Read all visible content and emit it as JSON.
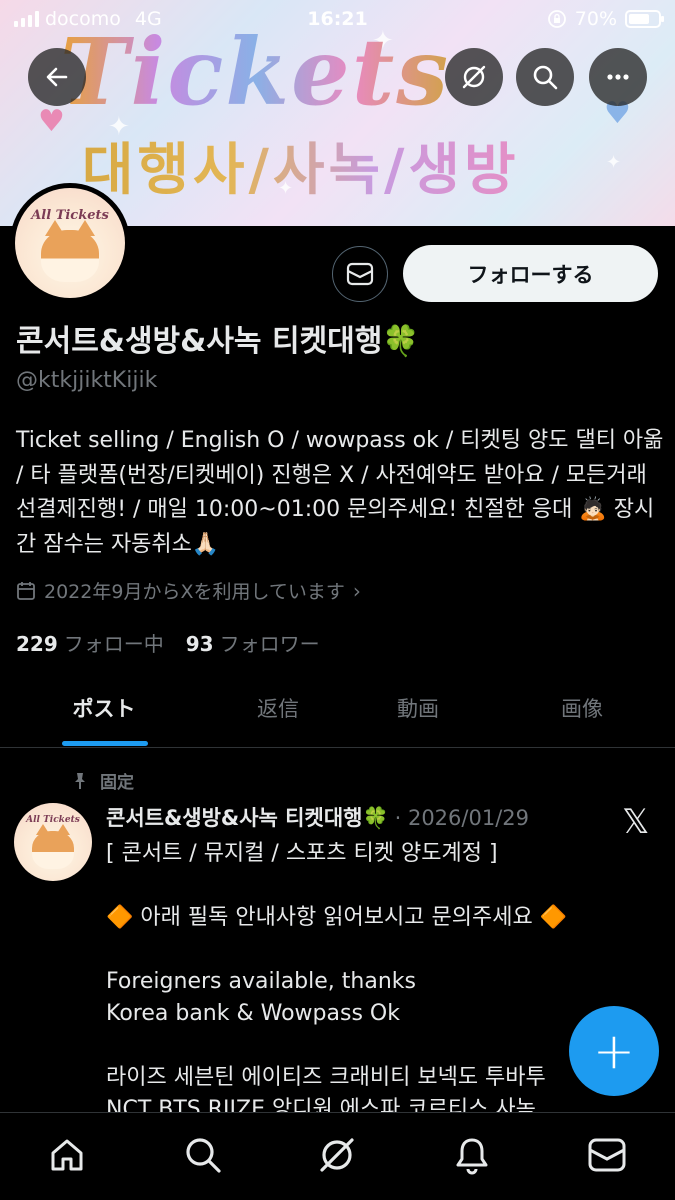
{
  "status_bar": {
    "carrier": "docomo",
    "network": "4G",
    "time": "16:21",
    "battery": "70%",
    "battery_level": 0.7
  },
  "banner": {
    "title": "Tickets",
    "subtitle": "대행사/사녹/생방"
  },
  "profile": {
    "avatar_label": "All Tickets",
    "follow_label": "フォローする",
    "display_name": "콘서트&생방&사녹 티켓대행🍀",
    "handle": "@ktkjjiktKijik",
    "bio": "Ticket selling / English O / wowpass ok / 티켓팅 양도 댈티 아옮 / 타 플랫폼(번장/티켓베이) 진행은 X / 사전예약도 받아요 / 모든거래 선결제진행! / 매일 10:00~01:00 문의주세요! 친절한 응대 🙇🏻 장시간 잠수는 자동취소🙏🏻",
    "joined": "2022年9月からXを利用しています",
    "following_count": "229",
    "following_label": "フォロー中",
    "followers_count": "93",
    "followers_label": "フォロワー"
  },
  "tabs": [
    {
      "label": "ポスト",
      "active": true
    },
    {
      "label": "返信",
      "active": false
    },
    {
      "label": "動画",
      "active": false
    },
    {
      "label": "画像",
      "active": false
    }
  ],
  "pinned_post": {
    "pinned_label": "固定",
    "avatar_label": "All Tickets",
    "author": "콘서트&생방&사녹 티켓대행🍀",
    "date": "· 2026/01/29",
    "text": "[ 콘서트 / 뮤지컬 / 스포츠 티켓 양도계정 ]\n\n🔶 아래 필독 안내사항 읽어보시고 문의주세요 🔶\n\nForeigners available, thanks\nKorea bank & Wowpass Ok\n\n라이즈 세븐틴 에이티즈 크래비티 보넥도 투바투\nNCT BTS RIIZE 앙디원 에스파 코르티스 사녹"
  },
  "fab": {
    "label": "+"
  },
  "colors": {
    "accent": "#1d9bf0",
    "background": "#000000",
    "secondary_text": "#71767b"
  },
  "icons": {
    "back": "arrow-left-icon",
    "grok": "grok-icon",
    "search": "search-icon",
    "more": "more-icon",
    "message": "mail-icon",
    "calendar": "calendar-icon",
    "pin": "pin-icon",
    "x_logo": "x-logo-icon",
    "nav": [
      "home-icon",
      "search-icon",
      "grok-icon",
      "bell-icon",
      "mail-icon"
    ]
  }
}
